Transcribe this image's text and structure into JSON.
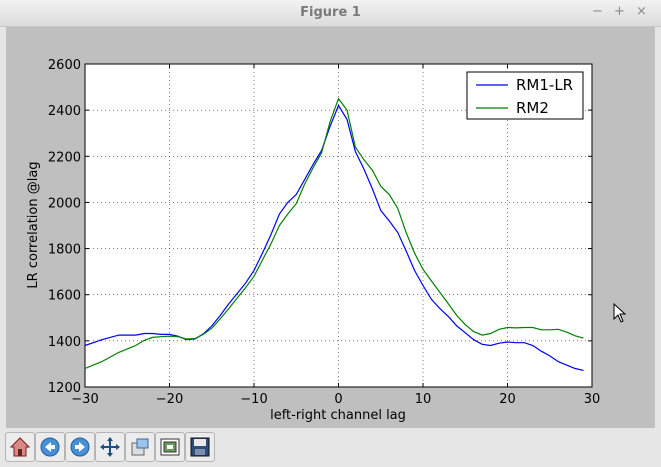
{
  "window": {
    "title": "Figure 1",
    "minimize": "−",
    "maximize": "+",
    "close": "×"
  },
  "chart_data": {
    "type": "line",
    "xlabel": "left-right channel lag",
    "ylabel": "LR correlation @lag",
    "xlim": [
      -30,
      30
    ],
    "ylim": [
      1200,
      2600
    ],
    "xticks": [
      -30,
      -20,
      -10,
      0,
      10,
      20,
      30
    ],
    "yticks": [
      1200,
      1400,
      1600,
      1800,
      2000,
      2200,
      2400,
      2600
    ],
    "grid": true,
    "legend_position": "top-right",
    "series": [
      {
        "name": "RM1-LR",
        "color": "#0000ff",
        "x": [
          -30,
          -28,
          -26,
          -24,
          -23,
          -22,
          -21,
          -20,
          -19,
          -18,
          -17,
          -16,
          -15,
          -14,
          -13,
          -12,
          -11,
          -10,
          -9,
          -8,
          -7,
          -6,
          -5,
          -4,
          -3,
          -2,
          -1,
          0,
          1,
          2,
          3,
          4,
          5,
          6,
          7,
          8,
          9,
          10,
          11,
          12,
          13,
          14,
          15,
          16,
          17,
          18,
          19,
          20,
          21,
          22,
          23,
          24,
          25,
          26,
          27,
          28,
          29
        ],
        "y": [
          1380,
          1405,
          1425,
          1425,
          1432,
          1432,
          1428,
          1428,
          1420,
          1405,
          1408,
          1430,
          1465,
          1510,
          1560,
          1605,
          1650,
          1705,
          1780,
          1860,
          1950,
          2000,
          2035,
          2100,
          2165,
          2225,
          2330,
          2420,
          2360,
          2220,
          2145,
          2060,
          1965,
          1920,
          1870,
          1790,
          1705,
          1640,
          1580,
          1540,
          1505,
          1465,
          1435,
          1405,
          1385,
          1380,
          1390,
          1395,
          1392,
          1392,
          1380,
          1355,
          1335,
          1310,
          1295,
          1280,
          1272
        ]
      },
      {
        "name": "RM2",
        "color": "#008000",
        "x": [
          -30,
          -28,
          -26,
          -24,
          -23,
          -22,
          -21,
          -20,
          -19,
          -18,
          -17,
          -16,
          -15,
          -14,
          -13,
          -12,
          -11,
          -10,
          -9,
          -8,
          -7,
          -6,
          -5,
          -4,
          -3,
          -2,
          -1,
          0,
          1,
          2,
          3,
          4,
          5,
          6,
          7,
          8,
          9,
          10,
          11,
          12,
          13,
          14,
          15,
          16,
          17,
          18,
          19,
          20,
          21,
          22,
          23,
          24,
          25,
          26,
          27,
          28,
          29
        ],
        "y": [
          1280,
          1310,
          1350,
          1380,
          1402,
          1415,
          1418,
          1420,
          1418,
          1408,
          1410,
          1428,
          1455,
          1495,
          1540,
          1585,
          1630,
          1680,
          1750,
          1820,
          1900,
          1950,
          1995,
          2080,
          2150,
          2215,
          2350,
          2450,
          2400,
          2240,
          2185,
          2140,
          2070,
          2035,
          1975,
          1870,
          1780,
          1710,
          1660,
          1610,
          1560,
          1510,
          1470,
          1440,
          1425,
          1432,
          1450,
          1458,
          1456,
          1458,
          1458,
          1448,
          1448,
          1450,
          1438,
          1422,
          1412
        ]
      }
    ]
  },
  "toolbar": {
    "items": [
      {
        "name": "home-icon"
      },
      {
        "name": "back-icon"
      },
      {
        "name": "forward-icon"
      },
      {
        "name": "pan-icon"
      },
      {
        "name": "zoom-icon"
      },
      {
        "name": "subplots-icon"
      },
      {
        "name": "save-icon"
      }
    ]
  }
}
